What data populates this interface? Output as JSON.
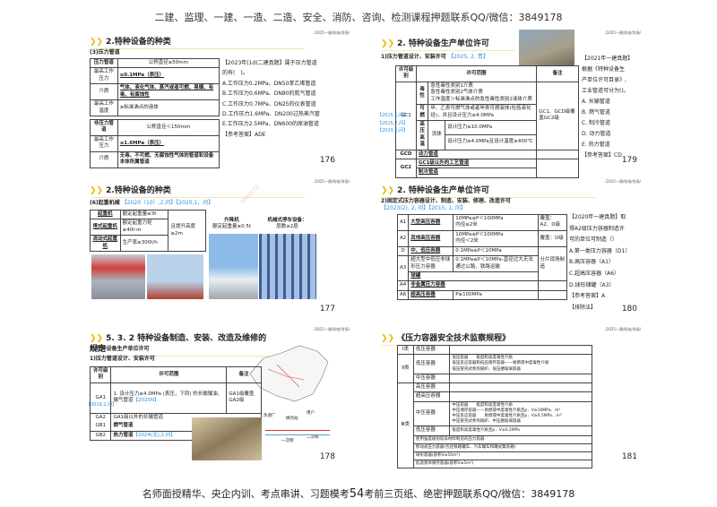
{
  "header": "二建、监理、一建、一造、二造、安全、消防、咨询、检测课程押题联系QQ/微信：3849178",
  "footer": {
    "left": "名师面授精华、央企内训、考点串讲、习题模考",
    "page": "54",
    "right": "考前三页纸、绝密押题联系QQ/微信：3849178"
  },
  "tag": "/2025一建/机电/肖扬/",
  "s1": {
    "title": "2.特种设备的种类",
    "sub": "(3)压力管道",
    "t1": [
      [
        "压力管道",
        "公称直径≥50mm"
      ],
      [
        "最高工作压力",
        "≥0.1MPa（表压）"
      ],
      [
        "介质",
        "气体、液化气体、蒸汽或者可燃、易爆、有毒、有腐蚀性"
      ],
      [
        "最高工作温度",
        "≥标准沸点的液体"
      ]
    ],
    "t2": [
      [
        "非压力管道",
        "公称直径＜150mm"
      ],
      [
        "最高工作压力",
        "≤1.6MPa（表压）"
      ],
      [
        "介质",
        "无毒、不可燃、无腐蚀性气体的管道和设备本体所属管道"
      ]
    ],
    "q": [
      "【2023年(1d)二建真题】属于压力管道",
      "的有(　)。",
      "A.工作压力0.2MPa、DN50苯乙烯管道",
      "B.工作压力0.6MPa、DN80的氮气管道",
      "C.工作压力0.7MPa、DN25的仪表管道",
      "D.工作压力1.6MPa、DN200过热蒸汽管",
      "E.工作压力2.5MPa、DN600的原油管道",
      "【参考答案】ADE"
    ],
    "page": "176"
  },
  "s2": {
    "title": "2. 特种设备生产单位许可",
    "sub": "1)压力管道设计、安装许可",
    "subtag": "【2025, 2, 责】",
    "head": [
      "许可级别",
      "许可范围",
      "备注"
    ],
    "gc1": "GC1",
    "rows": {
      "dx": "毒性",
      "dx_t": "急性毒性类别1介质\n急性毒性类别2气体介质\n工作温度＞标准沸点的急性毒性类别2液体介质",
      "kr": "可燃",
      "kr_t": "甲、乙类可燃气体或者甲类可燃液体(包括液化烃)，并且设计压力≥4.0MPa",
      "gy": "高压\n高温",
      "lt": "流体",
      "gy1": "设计压力≥10.0MPa",
      "gy2": "设计压力≥4.0MPa且设计温度≥400℃",
      "note": "GC1、GCD级覆盖GC2级",
      "gcd": "GCD",
      "gcd_t": "动力管道",
      "gc2": "GC2",
      "gc2_a": "GC1级以外的工艺管道",
      "gc2_b": "制冷管道"
    },
    "tags": [
      "【2015,1,问】",
      "【2015,2,问】",
      "【2020,1,问】"
    ],
    "q": [
      "【2021年一建真题】",
      "根据《特种设备生",
      "产单位许可目录》,",
      "工业管道可分为()。",
      "A. 长输管道",
      "B. 燃气管道",
      "C. 制冷管道",
      "D. 动力管道",
      "E. 热力管道",
      "【参考答案】CD"
    ],
    "page": "179"
  },
  "s3": {
    "title": "2.特种设备的种类",
    "sub": "(6)起重机械",
    "subtag": "【2020（10）,2,问】【2020,1，问】",
    "t": [
      [
        "起重机",
        "额定起重量≥3t"
      ],
      [
        "塔式起重机",
        "额定起重力矩≥40t·m"
      ],
      [
        "流动式起重机",
        "生产率≥300t/h"
      ]
    ],
    "side": "且提升高度≥2m",
    "lift": "升降机",
    "lift_s": "额定起重量≥0.5t",
    "park": "机械式停车设备：",
    "park_s": "层数≥2层",
    "page": "177"
  },
  "s4": {
    "title": "2. 特种设备生产单位许可",
    "sub": "2)固定式压力容器设计、制造、安装、修理、改造许可",
    "subtag": "【2023(2), 2, 问】【2015, 1, 问】",
    "rows": [
      [
        "A1",
        "大型高压容器",
        "10MPa≤P＜100MPa\n内径≥2米",
        "覆盖：A2、D级"
      ],
      [
        "A2",
        "其他高压容器",
        "10MPa≤P＜100MPa\n内径＜2米",
        "覆盖：D级"
      ],
      [
        "D",
        "中、低压容器",
        "0.1MPa≤P＜10MPa",
        ""
      ],
      [
        "A3",
        "超大型中低压非球形压力容器",
        "0.1MPa≤P＜10MPa-直径过大无法通过公路、铁路运输",
        "分片现场制造"
      ],
      [
        "",
        "球罐",
        "",
        ""
      ],
      [
        "A4",
        "非金属压力容器",
        "",
        ""
      ],
      [
        "A6",
        "超高压容器",
        "P≥100MPa",
        ""
      ]
    ],
    "q": [
      "【2020年一建真题】取",
      "得A2级压力容器制造许",
      "可的单位可制造（）",
      "A.第一类压力容器（D1）",
      "B.高压容器（A1）",
      "C.超高压容器（A6）",
      "D.球形储罐（A3）",
      "【参考答案】A",
      "【排除法】"
    ],
    "page": "180"
  },
  "s5": {
    "title": "5. 3. 2  特种设备制造、安装、改造及维修的规定",
    "sub1": "2.特种设备生产单位许可",
    "sub2": "1)压力管道设计、安装许可",
    "head": [
      "许可级别",
      "许可范围",
      "备注"
    ],
    "rows": [
      [
        "GA1",
        "1. 设计压力≥4.0MPa (表压，下同) 的长输输油、输气管道",
        "【2025N】",
        "GA1级覆盖GA2级"
      ],
      [
        "GA2",
        "GA1级以外的长输管道",
        "",
        ""
      ],
      [
        "GB1",
        "燃气管道",
        "",
        ""
      ],
      [
        "GB2",
        "热力管道",
        "【2024(北),2,问】",
        ""
      ]
    ],
    "tag": "【2019,2,问】",
    "diag": [
      "热源厂",
      "换热站",
      "用户",
      "一次网",
      "二次网"
    ],
    "page": "178"
  },
  "s6": {
    "title": "《压力容器安全技术监察规程》",
    "rows": [
      [
        "Ⅰ类",
        "低压容器",
        ""
      ],
      [
        "Ⅱ类",
        "低压容器",
        "低压容器　　极度和高度毒性介质\n低压反应容器和低压储存容器——易燃或中度毒性介质\n低压管壳式余热锅炉、低压搪玻璃容器"
      ],
      [
        "",
        "中压容器",
        ""
      ],
      [
        "Ⅲ类",
        "高压容器",
        ""
      ],
      [
        "",
        "超高压容器",
        ""
      ],
      [
        "",
        "中压容器",
        "中压容器　　极度和高度毒性介质\n中压储存容器——易燃或中度毒性介质且p．V≥10MPa．m³\n中压反应容器　　易燃或中度毒性介质且p．V≥0.5MPa．m³\n中压管壳式余热锅炉、中压搪玻璃容器"
      ],
      [
        "",
        "低压容器",
        "极度和高度毒性介质且p．V≥0.2MPa"
      ],
      [
        "",
        "使用强度级别较高材料制造的压力容器",
        ""
      ],
      [
        "",
        "移动式压力容器(包括铁路罐车、汽车罐车和罐式集装箱)",
        ""
      ],
      [
        "",
        "球形容器(容积V≥50m³)",
        ""
      ],
      [
        "",
        "低温液体储存容器(容积V≥5m³)",
        ""
      ]
    ],
    "page": "181"
  }
}
